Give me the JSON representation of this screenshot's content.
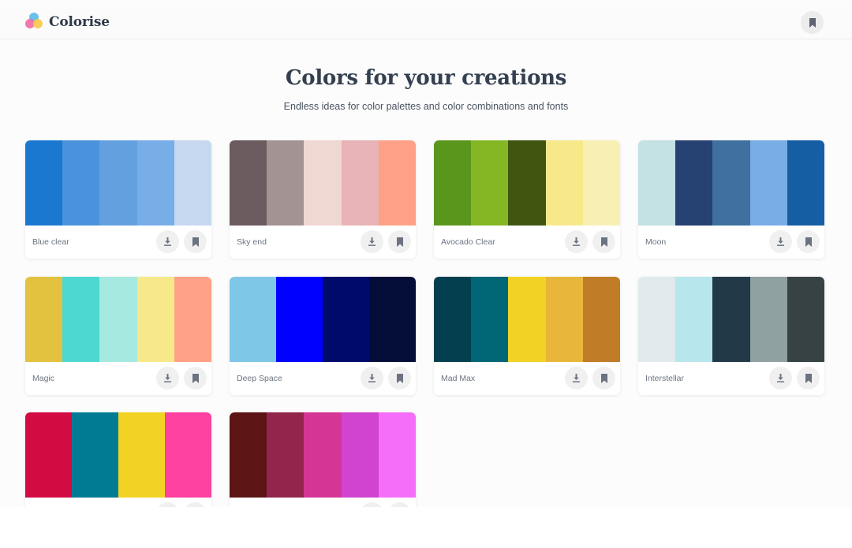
{
  "app": {
    "name": "Colorise"
  },
  "hero": {
    "title": "Colors for your creations",
    "subtitle": "Endless ideas for color palettes and color combinations and fonts"
  },
  "icons": {
    "logo": "overlapping-circles-logo",
    "download": "download-icon",
    "bookmark": "bookmark-icon"
  },
  "palettes": [
    {
      "name": "Blue clear",
      "colors": [
        "#1b78d0",
        "#4a93dc",
        "#62a0e0",
        "#78aee8",
        "#c6d8f0"
      ]
    },
    {
      "name": "Sky end",
      "colors": [
        "#6b5a5e",
        "#a39493",
        "#efd7d2",
        "#e8b3b6",
        "#ffa187"
      ]
    },
    {
      "name": "Avocado Clear",
      "colors": [
        "#5a961c",
        "#85b725",
        "#3f5510",
        "#f7e88a",
        "#f8f0b2"
      ]
    },
    {
      "name": "Moon",
      "colors": [
        "#c4e1e4",
        "#264272",
        "#3f70a0",
        "#78aee6",
        "#155ea4"
      ]
    },
    {
      "name": "Magic",
      "colors": [
        "#e3c23f",
        "#4dd9d2",
        "#a5e9e0",
        "#f7e88a",
        "#ffa187"
      ]
    },
    {
      "name": "Deep Space",
      "colors": [
        "#7fc7e6",
        "#0000ff",
        "#000a6b",
        "#040c38"
      ]
    },
    {
      "name": "Mad Max",
      "colors": [
        "#03404f",
        "#016675",
        "#f2d325",
        "#e8b63a",
        "#c17c28"
      ]
    },
    {
      "name": "Interstellar",
      "colors": [
        "#e0eaed",
        "#b7e6ec",
        "#223948",
        "#8fa1a0",
        "#364244"
      ]
    },
    {
      "name": "",
      "colors": [
        "#d20c43",
        "#017b93",
        "#f2d325",
        "#fd41a0"
      ]
    },
    {
      "name": "",
      "colors": [
        "#5c1414",
        "#93254d",
        "#d53595",
        "#d044cf",
        "#f46ef9"
      ]
    }
  ]
}
